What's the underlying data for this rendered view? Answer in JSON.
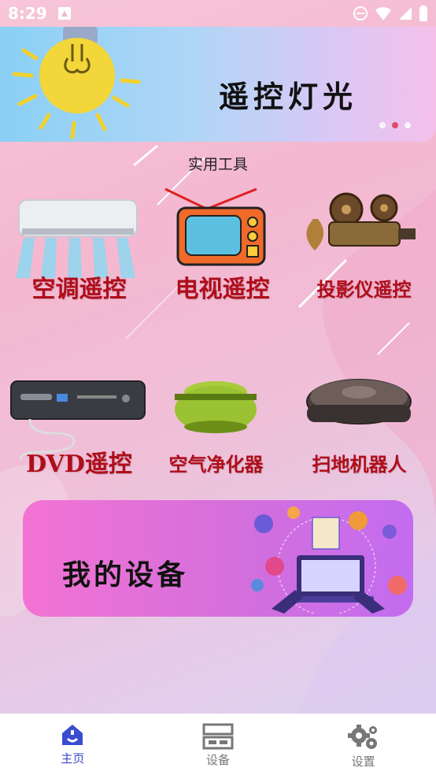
{
  "status_bar": {
    "time": "8:29"
  },
  "banner": {
    "title": "遥控灯光",
    "page_count": 3,
    "active_page": 2
  },
  "section": {
    "title": "实用工具"
  },
  "tools": [
    {
      "label": "空调遥控",
      "icon": "air-conditioner-icon"
    },
    {
      "label": "电视遥控",
      "icon": "tv-icon"
    },
    {
      "label": "投影仪遥控",
      "icon": "projector-icon"
    },
    {
      "label": "DVD遥控",
      "icon": "dvd-player-icon"
    },
    {
      "label": "空气净化器",
      "icon": "air-purifier-icon"
    },
    {
      "label": "扫地机器人",
      "icon": "robot-vacuum-icon"
    }
  ],
  "my_devices": {
    "title": "我的设备"
  },
  "bottom_nav": {
    "items": [
      {
        "label": "主页",
        "icon": "home-icon",
        "active": true
      },
      {
        "label": "设备",
        "icon": "devices-icon",
        "active": false
      },
      {
        "label": "设置",
        "icon": "settings-gear-icon",
        "active": false
      }
    ]
  },
  "colors": {
    "accent": "#3a4ccf",
    "tool_label": "#b00d1a"
  }
}
